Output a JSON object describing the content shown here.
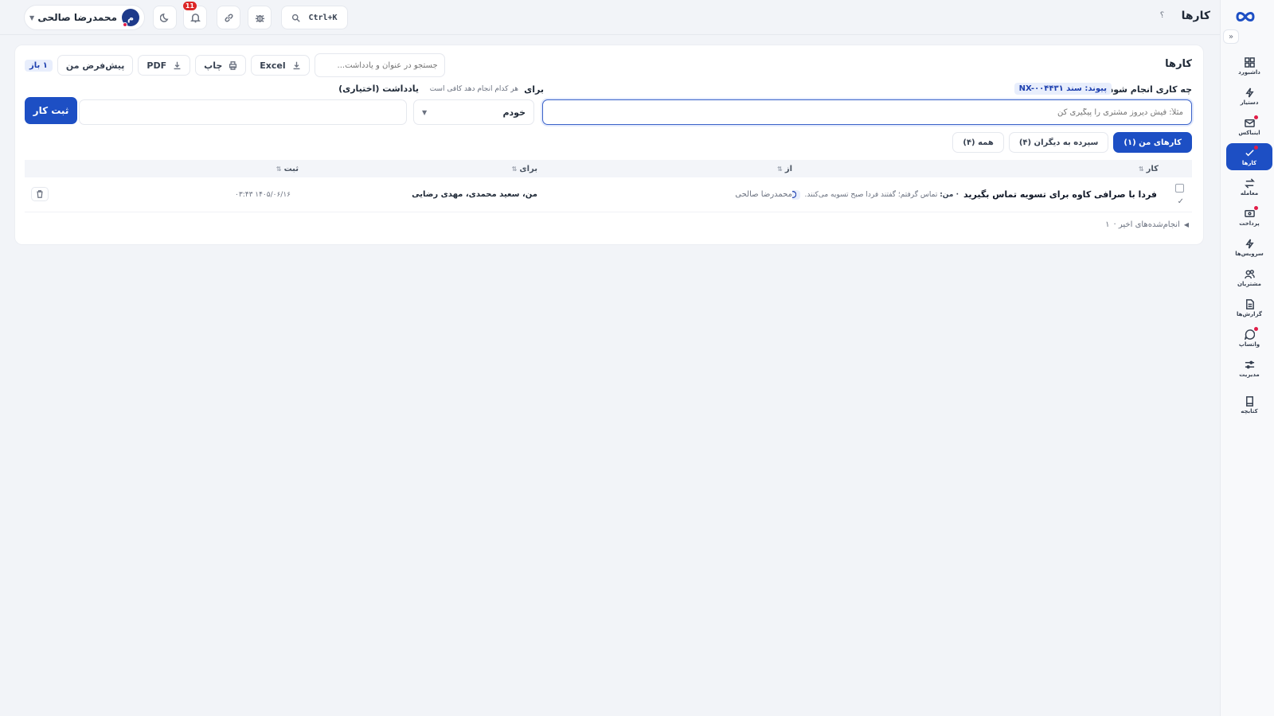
{
  "app": {
    "page_title": "کارها",
    "help_mark": "؟"
  },
  "topbar": {
    "user_name": "محمدرضا صالحی",
    "user_initial": "م",
    "notifications_count": "11",
    "search_shortcut": "Ctrl+K"
  },
  "sidebar": {
    "items": [
      {
        "label": "داشبورد",
        "icon": "grid-icon"
      },
      {
        "label": "دستیار",
        "icon": "bolt-icon"
      },
      {
        "label": "اینباکس",
        "icon": "inbox-icon"
      },
      {
        "label": "کارها",
        "icon": "task-icon"
      },
      {
        "label": "معامله",
        "icon": "exchange-icon"
      },
      {
        "label": "پرداخت",
        "icon": "card-icon"
      },
      {
        "label": "سرویس‌ها",
        "icon": "bolt-icon"
      },
      {
        "label": "مشتریان",
        "icon": "users-icon"
      },
      {
        "label": "گزارش‌ها",
        "icon": "report-icon"
      },
      {
        "label": "واتساپ",
        "icon": "chat-icon"
      },
      {
        "label": "مدیریت",
        "icon": "sliders-icon"
      },
      {
        "label": "کتابچه",
        "icon": "book-icon"
      }
    ]
  },
  "card": {
    "title": "کارها",
    "open_badge": "۱ باز",
    "my_default": "پیش‌فرض من",
    "pdf": "PDF",
    "print": "چاپ",
    "excel": "Excel",
    "search_placeholder": "جستجو در عنوان و یادداشت..."
  },
  "form": {
    "what_label": "چه کاری انجام شود؟",
    "link_tag": "پیوند: سند NX-۰۰۴۴۳۱",
    "for_label": "برای",
    "for_hint": "هر کدام انجام دهد کافی است",
    "note_label": "یادداشت (اختیاری)",
    "task_placeholder": "مثلاً: فیش دیروز مشتری را پیگیری کن",
    "assignee_value": "خودم",
    "submit": "ثبت کار"
  },
  "tabs": [
    {
      "label": "کارهای من (۱)"
    },
    {
      "label": "سپرده به دیگران (۴)"
    },
    {
      "label": "همه (۴)"
    }
  ],
  "table": {
    "headers": {
      "task": "کار",
      "from": "از",
      "for": "برای",
      "registered": "ثبت",
      "sort_mark": "⇅"
    },
    "rows": [
      {
        "title": "فردا با صرافی کاوه برای تسویه تماس بگیرید",
        "note_prefix": "· من:",
        "note": "تماس گرفتم؛ گفتند فردا صبح تسویه می‌کنند.",
        "comments": "۱",
        "from": "محمدرضا صالحی",
        "for": "من، سعید محمدی، مهدی رضایی",
        "registered": "۰۳:۴۳ ۱۴۰۵/۰۶/۱۶"
      }
    ]
  },
  "recent": {
    "label": "انجام‌شده‌های اخیر ·",
    "count": "۱"
  },
  "colors": {
    "primary": "#1d4fc4",
    "danger": "#dc2626",
    "tag_bg": "#e8eefc"
  }
}
